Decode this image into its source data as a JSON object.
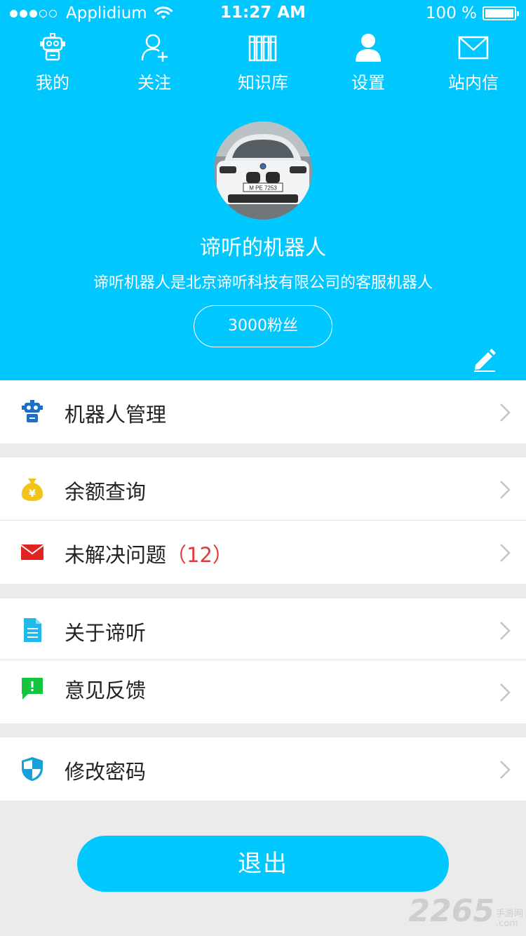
{
  "status_bar": {
    "carrier": "Applidium",
    "time": "11:27 AM",
    "battery": "100 %"
  },
  "nav": [
    {
      "label": "我的",
      "icon": "robot-icon"
    },
    {
      "label": "关注",
      "icon": "add-user-icon"
    },
    {
      "label": "知识库",
      "icon": "books-icon"
    },
    {
      "label": "设置",
      "icon": "person-icon"
    },
    {
      "label": "站内信",
      "icon": "mail-icon"
    }
  ],
  "profile": {
    "name": "谛听的机器人",
    "description": "谛听机器人是北京谛听科技有限公司的客服机器人",
    "fans": "3000粉丝",
    "plate": "M PE 7253"
  },
  "menu_groups": [
    [
      {
        "label": "机器人管理",
        "icon": "robot-icon",
        "color": "#1b6ec9"
      }
    ],
    [
      {
        "label": "余额查询",
        "icon": "money-bag-icon",
        "color": "#f0c419"
      },
      {
        "label": "未解决问题",
        "badge": "（12）",
        "icon": "mail-icon",
        "color": "#e0241f"
      }
    ],
    [
      {
        "label": "关于谛听",
        "icon": "document-icon",
        "color": "#22b8e8"
      },
      {
        "label": "意见反馈",
        "icon": "feedback-icon",
        "color": "#16c43f"
      }
    ],
    [
      {
        "label": "修改密码",
        "icon": "shield-icon",
        "color": "#1aa0d8"
      }
    ]
  ],
  "logout_label": "退出",
  "watermark": {
    "number": "2265",
    "site_cn": "手游网",
    "site_en": ".com"
  },
  "colors": {
    "primary": "#00c8ff",
    "background": "#ebebeb",
    "badge": "#e33b3b"
  }
}
